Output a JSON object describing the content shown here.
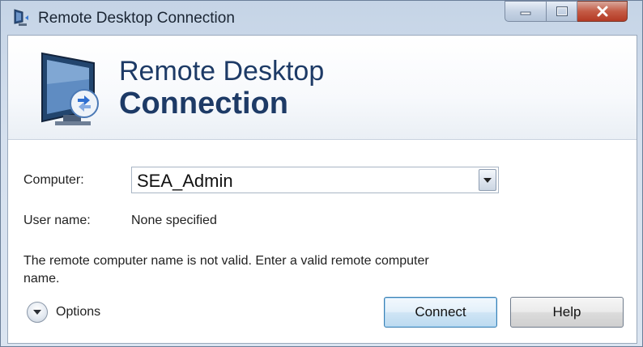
{
  "window": {
    "title": "Remote Desktop Connection"
  },
  "titlebar": {
    "icons": [
      "app-icon",
      "minimize-icon",
      "maximize-icon",
      "close-icon"
    ]
  },
  "banner": {
    "line1": "Remote Desktop",
    "line2": "Connection",
    "logo_icon": "remote-desktop-monitor-icon"
  },
  "form": {
    "computer_label": "Computer:",
    "computer_value": "SEA_Admin",
    "username_label": "User name:",
    "username_value": "None specified",
    "message": "The remote computer name is not valid. Enter a valid remote computer name."
  },
  "footer": {
    "options_label": "Options",
    "connect_label": "Connect",
    "help_label": "Help"
  },
  "colors": {
    "title_text": "#1d3a66",
    "close_button": "#c45b45",
    "default_button_border": "#3c7fb1"
  }
}
